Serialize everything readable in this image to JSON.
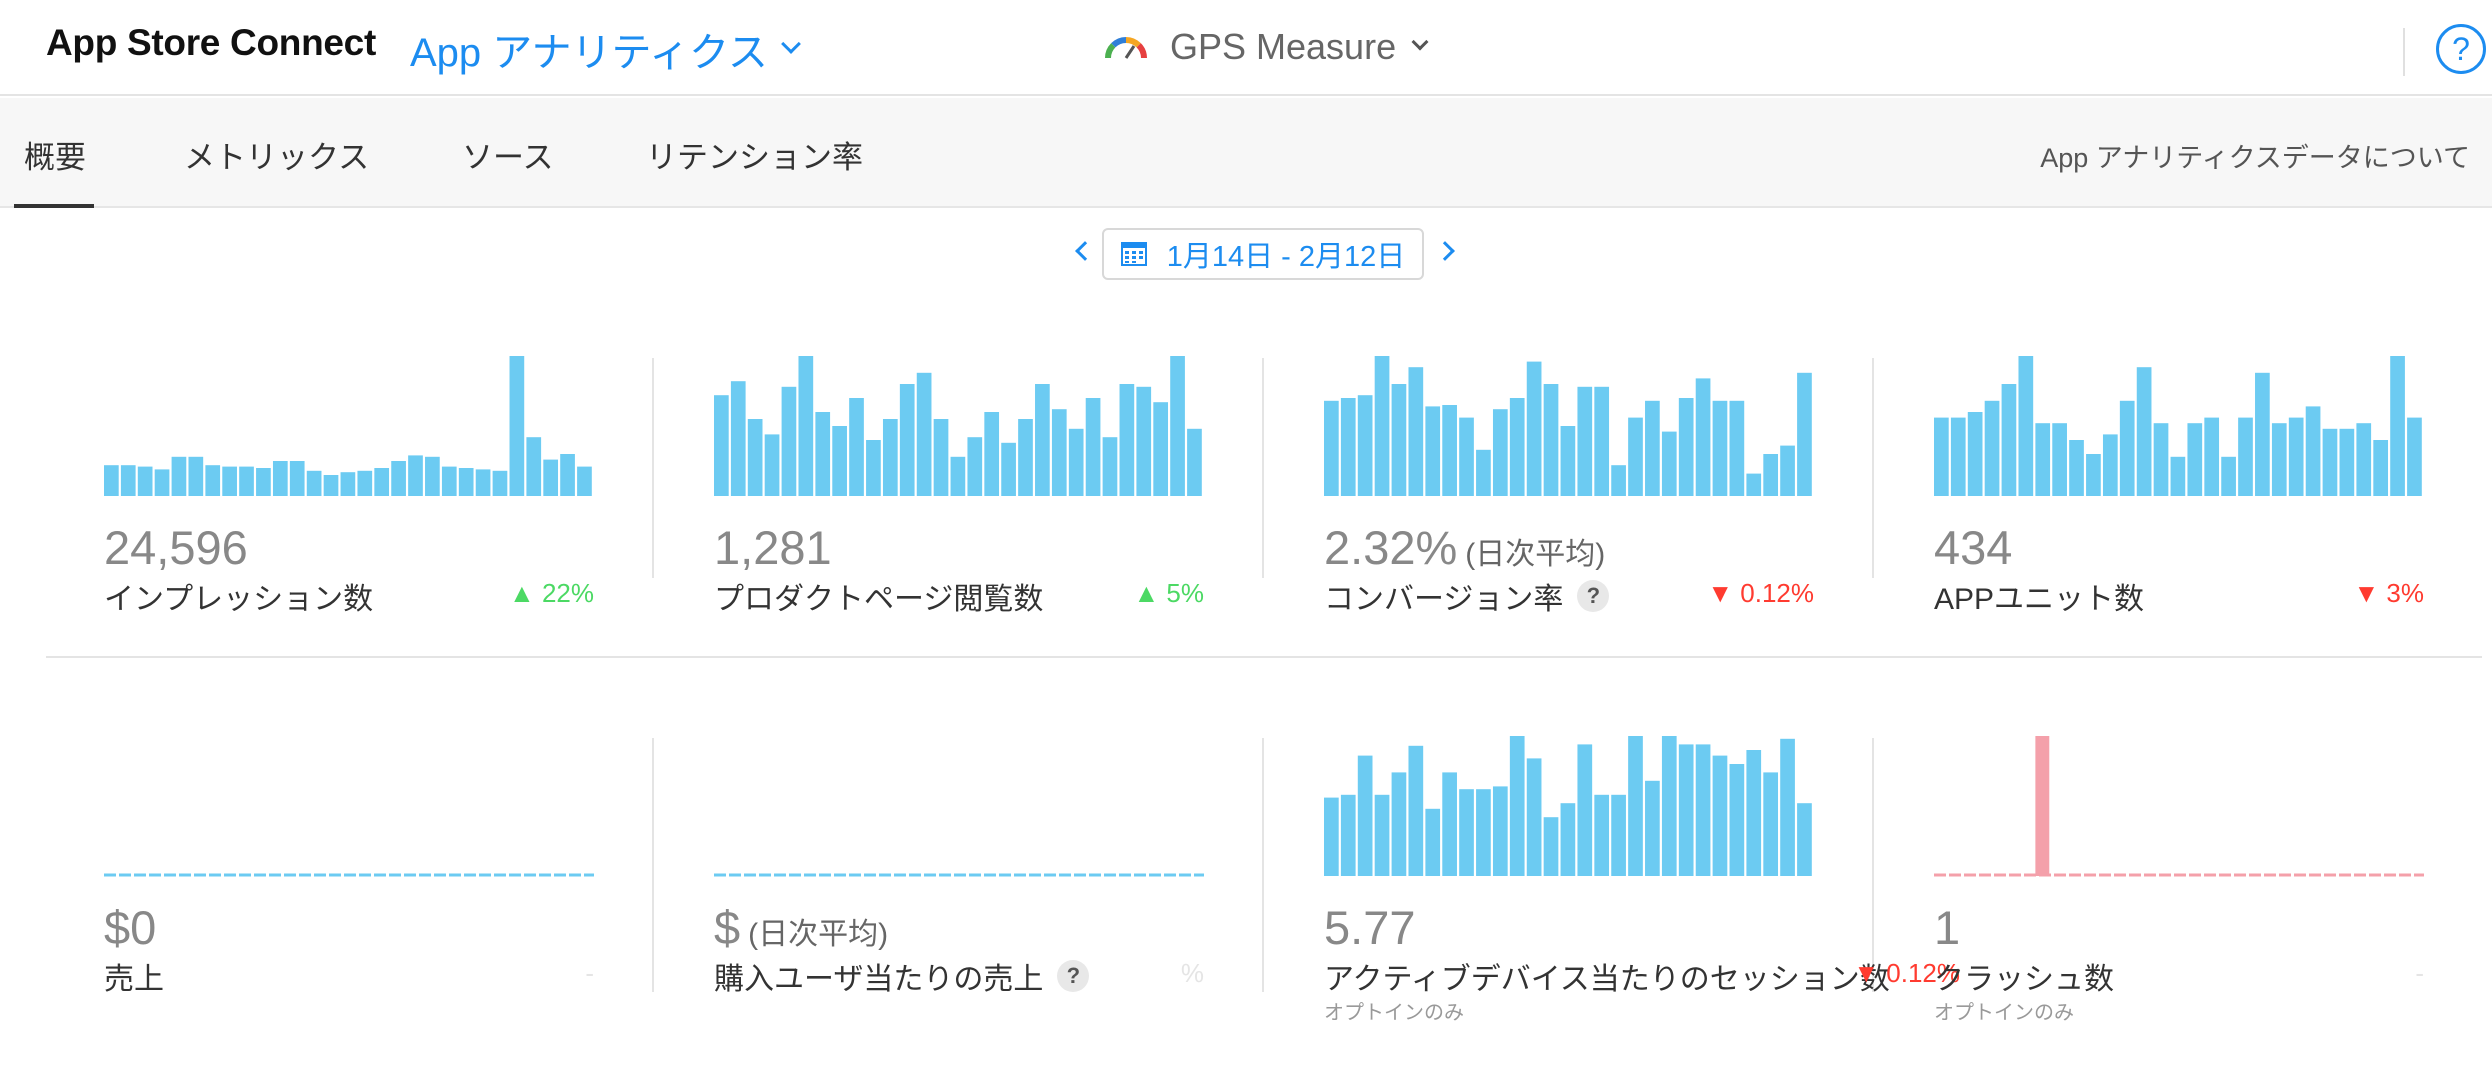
{
  "header": {
    "brand": "App Store Connect",
    "module": "App アナリティクス",
    "app_name": "GPS Measure",
    "help": "?"
  },
  "tabs": [
    {
      "label": "概要",
      "active": true
    },
    {
      "label": "メトリックス",
      "active": false
    },
    {
      "label": "ソース",
      "active": false
    },
    {
      "label": "リテンション率",
      "active": false
    }
  ],
  "about_link": "App アナリティクスデータについて",
  "date_range": "1月14日 - 2月12日",
  "colors": {
    "accent": "#1c8cf0",
    "bar": "#6ccbf2",
    "crash_bar": "#f4a0aa",
    "up": "#4cd964",
    "down": "#ff3b30"
  },
  "metrics": [
    {
      "value": "24,596",
      "value_suffix": "",
      "label": "インプレッション数",
      "help": "",
      "sub": "",
      "change": "▲ 22%",
      "direction": "up",
      "kind": "bars",
      "color": "#6ccbf2",
      "series": [
        0.22,
        0.22,
        0.21,
        0.19,
        0.28,
        0.28,
        0.22,
        0.21,
        0.21,
        0.2,
        0.25,
        0.25,
        0.18,
        0.15,
        0.17,
        0.18,
        0.2,
        0.25,
        0.29,
        0.28,
        0.21,
        0.2,
        0.19,
        0.18,
        1.0,
        0.42,
        0.26,
        0.3,
        0.21
      ]
    },
    {
      "value": "1,281",
      "value_suffix": "",
      "label": "プロダクトページ閲覧数",
      "help": "",
      "sub": "",
      "change": "▲ 5%",
      "direction": "up",
      "kind": "bars",
      "color": "#6ccbf2",
      "series": [
        0.72,
        0.82,
        0.55,
        0.44,
        0.78,
        1.0,
        0.6,
        0.5,
        0.7,
        0.4,
        0.55,
        0.8,
        0.88,
        0.55,
        0.28,
        0.42,
        0.6,
        0.38,
        0.55,
        0.8,
        0.62,
        0.48,
        0.7,
        0.42,
        0.8,
        0.78,
        0.67,
        1.0,
        0.48
      ]
    },
    {
      "value": "2.32%",
      "value_suffix": "(日次平均)",
      "label": "コンバージョン率",
      "help": "?",
      "sub": "",
      "change": "▼ 0.12%",
      "direction": "down",
      "kind": "bars",
      "color": "#6ccbf2",
      "series": [
        0.68,
        0.7,
        0.72,
        1.0,
        0.8,
        0.92,
        0.64,
        0.65,
        0.56,
        0.33,
        0.62,
        0.7,
        0.96,
        0.8,
        0.5,
        0.78,
        0.78,
        0.22,
        0.56,
        0.68,
        0.46,
        0.7,
        0.84,
        0.68,
        0.68,
        0.16,
        0.3,
        0.36,
        0.88
      ]
    },
    {
      "value": "434",
      "value_suffix": "",
      "label": "APPユニット数",
      "help": "",
      "sub": "",
      "change": "▼ 3%",
      "direction": "down",
      "kind": "bars",
      "color": "#6ccbf2",
      "series": [
        0.56,
        0.56,
        0.6,
        0.68,
        0.8,
        1.0,
        0.52,
        0.52,
        0.4,
        0.3,
        0.44,
        0.68,
        0.92,
        0.52,
        0.28,
        0.52,
        0.56,
        0.28,
        0.56,
        0.88,
        0.52,
        0.56,
        0.64,
        0.48,
        0.48,
        0.52,
        0.4,
        1.0,
        0.56
      ]
    },
    {
      "value": "$0",
      "value_suffix": "",
      "label": "売上",
      "help": "",
      "sub": "",
      "change": "-",
      "direction": "faded",
      "kind": "flat",
      "color": "#6ccbf2",
      "series": []
    },
    {
      "value": "$",
      "value_suffix": "(日次平均)",
      "label": "購入ユーザ当たりの売上",
      "help": "?",
      "sub": "",
      "change": "%",
      "direction": "faded",
      "kind": "flat",
      "color": "#6ccbf2",
      "series": []
    },
    {
      "value": "5.77",
      "value_suffix": "",
      "label": "アクティブデバイス当たりのセッション数",
      "help": "",
      "sub": "オプトインのみ",
      "change": "▼ 0.12%",
      "direction": "down",
      "kind": "bars",
      "color": "#6ccbf2",
      "series": [
        0.56,
        0.58,
        0.86,
        0.58,
        0.74,
        0.93,
        0.48,
        0.74,
        0.62,
        0.62,
        0.64,
        1.0,
        0.84,
        0.42,
        0.52,
        0.94,
        0.58,
        0.58,
        1.0,
        0.68,
        1.0,
        0.94,
        0.94,
        0.86,
        0.8,
        0.9,
        0.74,
        0.98,
        0.52
      ]
    },
    {
      "value": "1",
      "value_suffix": "",
      "label": "クラッシュ数",
      "help": "",
      "sub": "オプトインのみ",
      "change": "-",
      "direction": "faded",
      "kind": "spike",
      "color": "#f4a0aa",
      "spike_index": 6,
      "series_length": 29
    }
  ]
}
